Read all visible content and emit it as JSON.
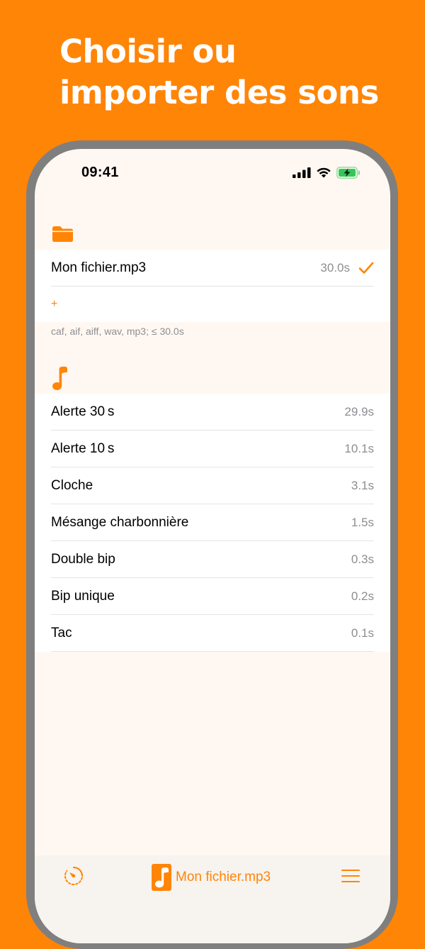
{
  "headline": {
    "line1": "Choisir ou",
    "line2": "importer des sons"
  },
  "status_bar": {
    "time": "09:41"
  },
  "files_section": {
    "icon": "folder-icon",
    "selected_file": {
      "name": "Mon fichier.mp3",
      "duration": "30.0s",
      "checked": true
    },
    "add_label": "+",
    "footer": "caf, aif, aiff, wav, mp3; ≤ 30.0s"
  },
  "sounds_section": {
    "icon": "music-note-icon",
    "items": [
      {
        "label": "Alerte 30 s",
        "duration": "29.9s"
      },
      {
        "label": "Alerte 10 s",
        "duration": "10.1s"
      },
      {
        "label": "Cloche",
        "duration": "3.1s"
      },
      {
        "label": "Mésange charbonnière",
        "duration": "1.5s"
      },
      {
        "label": "Double bip",
        "duration": "0.3s"
      },
      {
        "label": "Bip unique",
        "duration": "0.2s"
      },
      {
        "label": "Tac",
        "duration": "0.1s"
      }
    ]
  },
  "tab_bar": {
    "current_sound": "Mon fichier.mp3",
    "left_icon": "timer-icon",
    "center_icon": "music-note-icon",
    "right_icon": "menu-icon"
  },
  "colors": {
    "accent": "#FF8507",
    "background": "#FFF8F2",
    "secondary_text": "#8e8e93"
  }
}
